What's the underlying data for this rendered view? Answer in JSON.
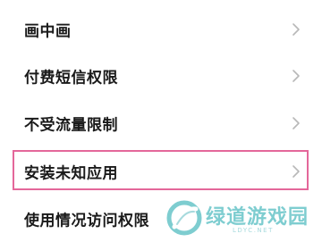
{
  "settings": {
    "items": [
      {
        "label": "画中画",
        "icon": "chevron-right-icon"
      },
      {
        "label": "付费短信权限",
        "icon": "chevron-right-icon"
      },
      {
        "label": "不受流量限制",
        "icon": "chevron-right-icon"
      },
      {
        "label": "安装未知应用",
        "icon": "chevron-right-icon",
        "highlighted": true
      },
      {
        "label": "使用情况访问权限",
        "icon": "chevron-right-icon"
      }
    ]
  },
  "highlight": {
    "color": "#e4679a"
  },
  "watermark": {
    "brand": "绿道游戏园",
    "domain": "LDYC.NET",
    "color": "#5bbfc4",
    "icon": "ldyc-logo-icon"
  }
}
